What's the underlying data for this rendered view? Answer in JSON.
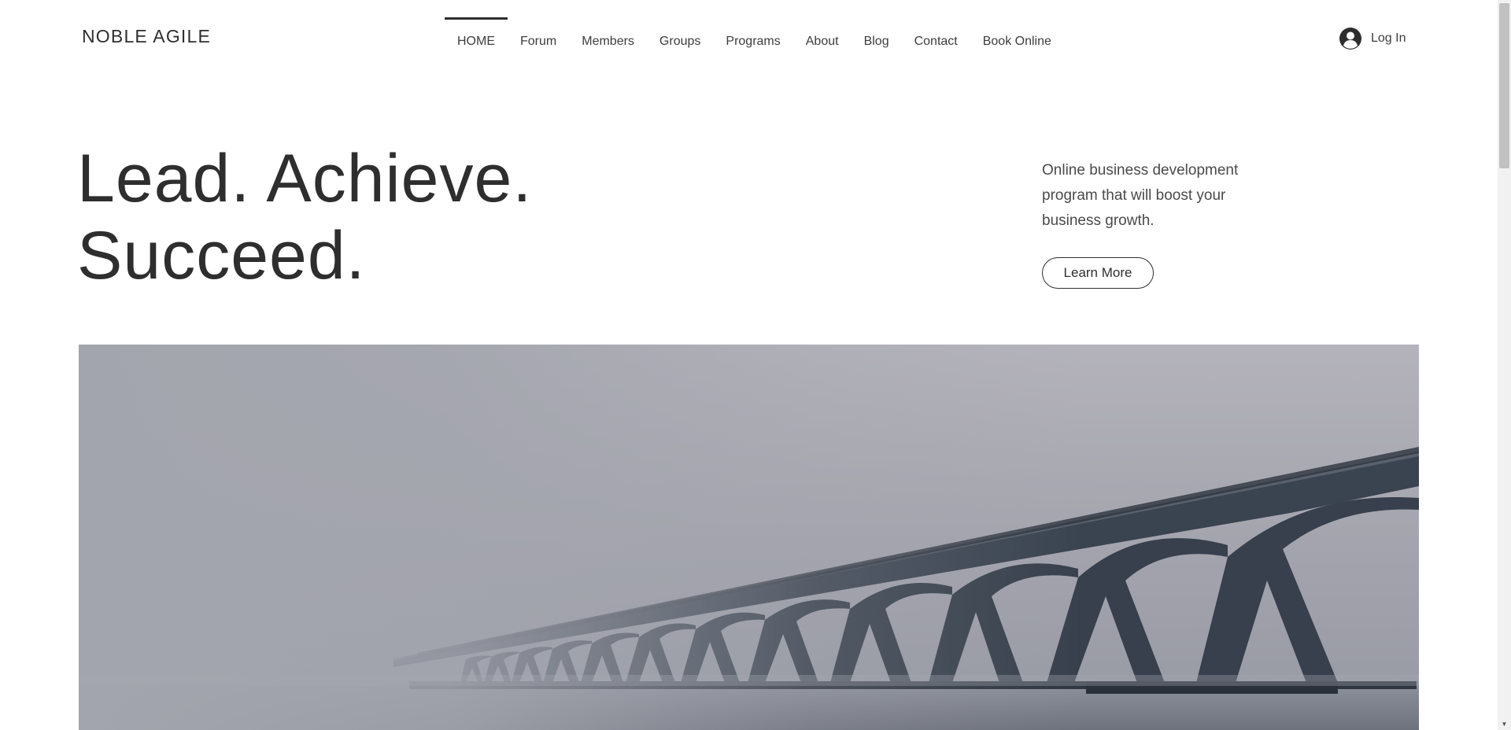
{
  "header": {
    "logo": "NOBLE AGILE",
    "nav": [
      {
        "label": "HOME",
        "active": true
      },
      {
        "label": "Forum"
      },
      {
        "label": "Members"
      },
      {
        "label": "Groups"
      },
      {
        "label": "Programs"
      },
      {
        "label": "About"
      },
      {
        "label": "Blog"
      },
      {
        "label": "Contact"
      },
      {
        "label": "Book Online"
      }
    ],
    "login_label": "Log In",
    "login_icon": "user-avatar-icon"
  },
  "hero": {
    "title_line1": "Lead. Achieve.",
    "title_line2": "Succeed.",
    "description": "Online business development program that will boost your business growth.",
    "button_label": "Learn More",
    "image_subject": "bridge-in-fog-image"
  },
  "colors": {
    "text": "#2f2e2e",
    "background": "#ffffff",
    "sky": "#a9a9b3",
    "bridge": "#3a4350"
  },
  "scrollbar": {
    "up_icon": "scroll-up-icon",
    "down_icon": "scroll-down-icon"
  }
}
